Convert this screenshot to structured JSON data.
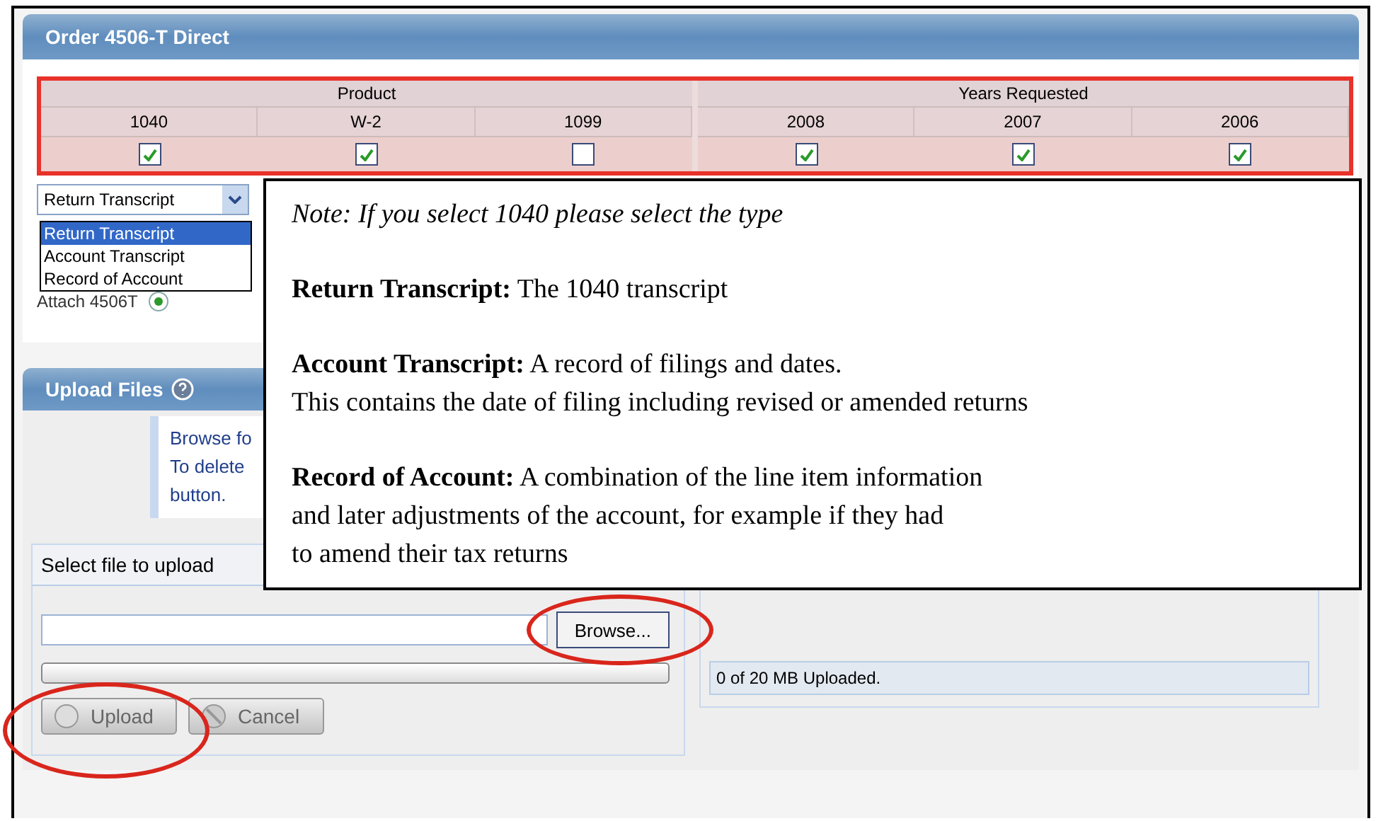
{
  "panel": {
    "title": "Order 4506-T Direct"
  },
  "selection_table": {
    "groups": [
      {
        "heading": "Product",
        "columns": [
          {
            "label": "1040",
            "checked": true
          },
          {
            "label": "W-2",
            "checked": true
          },
          {
            "label": "1099",
            "checked": false
          }
        ]
      },
      {
        "heading": "Years Requested",
        "columns": [
          {
            "label": "2008",
            "checked": true
          },
          {
            "label": "2007",
            "checked": true
          },
          {
            "label": "2006",
            "checked": true
          }
        ]
      }
    ]
  },
  "transcript_type": {
    "value": "Return Transcript",
    "options": [
      {
        "label": "Return Transcript",
        "selected": true
      },
      {
        "label": "Account Transcript",
        "selected": false
      },
      {
        "label": "Record of Account",
        "selected": false
      }
    ]
  },
  "delivery": {
    "options": [
      {
        "label": "Attach 4506T",
        "selected": true
      }
    ]
  },
  "upload": {
    "title": "Upload Files",
    "instructions": [
      "Browse fo",
      "To delete",
      "button."
    ],
    "select_file": {
      "title": "Select file to upload",
      "browse": "Browse...",
      "progress": {
        "level": 0
      },
      "buttons": [
        {
          "kind": "upload",
          "label": "Upload",
          "disabled": true
        },
        {
          "kind": "cancel",
          "label": "Cancel",
          "disabled": true
        }
      ]
    },
    "uploaded": {
      "status": "0 of 20 MB Uploaded."
    }
  },
  "note": {
    "intro": "Note: If you select 1040 please select the type",
    "entries": [
      {
        "lines": [
          "**Return Transcript:** The 1040 transcript"
        ]
      },
      {
        "lines": [
          "**Account Transcript:**  A record of filings and dates.",
          "This contains the date of filing including revised or amended returns"
        ]
      },
      {
        "lines": [
          "**Record of Account:** A combination of the line item information",
          "and later adjustments of the account, for example if they had",
          "to amend their tax returns"
        ]
      }
    ]
  }
}
